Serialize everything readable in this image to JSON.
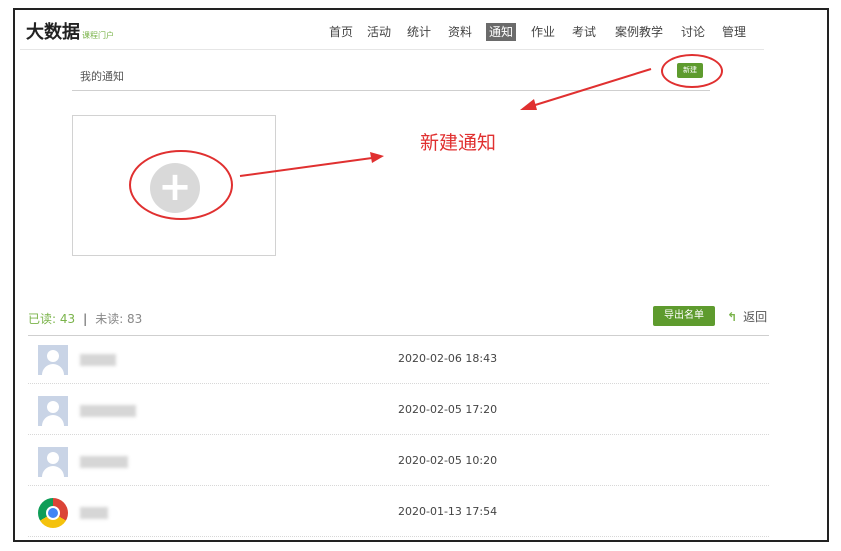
{
  "app": {
    "title": "大数据",
    "subtitle": "课程门户"
  },
  "nav": {
    "items": [
      "首页",
      "活动",
      "统计",
      "资料",
      "通知",
      "作业",
      "考试",
      "案例教学",
      "讨论",
      "管理"
    ],
    "active": "通知"
  },
  "subbar": {
    "title": "我的通知",
    "new_button": "新建"
  },
  "callout": {
    "text": "新建通知"
  },
  "stats": {
    "read_label": "已读: 43",
    "separator": "|",
    "unread_label": "未读: 83"
  },
  "actions": {
    "export": "导出名单",
    "back": "返回"
  },
  "colors": {
    "accent": "#5e9b2e",
    "highlight": "#e03030",
    "nav_active": "#6b6b6b"
  },
  "rows": [
    {
      "avatar": "user-placeholder-icon",
      "time": "2020-02-06 18:43"
    },
    {
      "avatar": "user-placeholder-icon",
      "time": "2020-02-05 17:20"
    },
    {
      "avatar": "user-placeholder-icon",
      "time": "2020-02-05 10:20"
    },
    {
      "avatar": "chrome-icon",
      "time": "2020-01-13 17:54"
    }
  ]
}
